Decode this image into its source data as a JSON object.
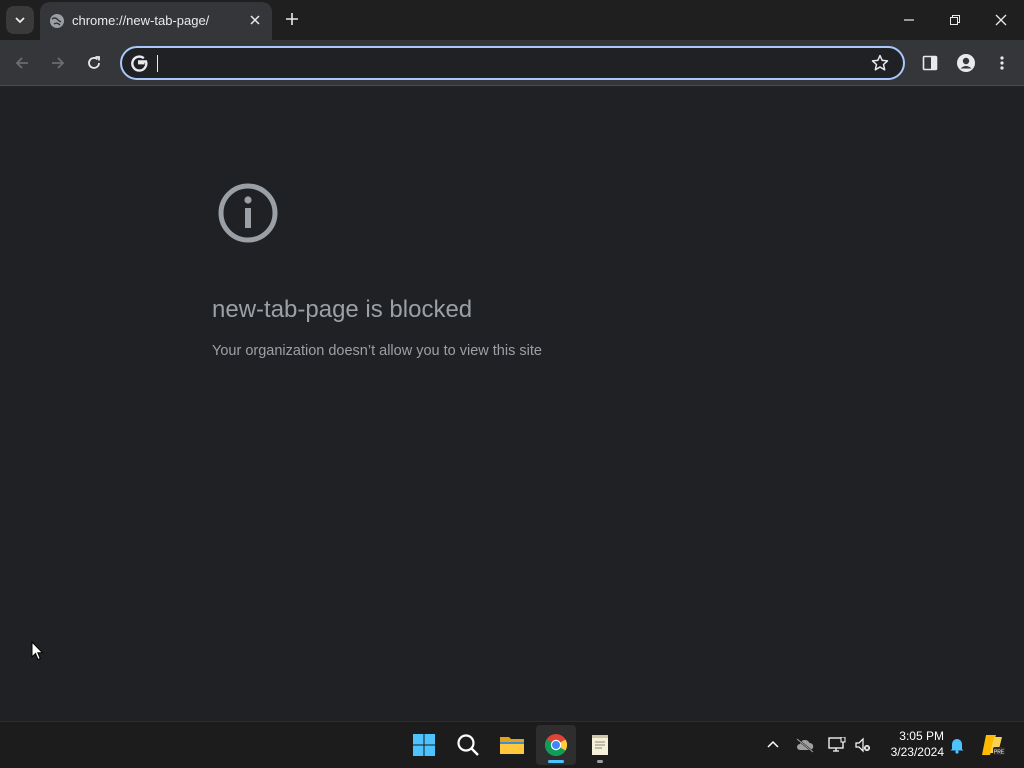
{
  "browser": {
    "tab": {
      "title": "chrome://new-tab-page/"
    },
    "omnibox": {
      "value": "",
      "placeholder": ""
    }
  },
  "page": {
    "headline": "new-tab-page is blocked",
    "message": "Your organization doesn’t allow you to view this site"
  },
  "taskbar": {
    "apps": [
      "start-icon",
      "search-icon",
      "file-explorer-icon",
      "chrome-icon",
      "notepad-icon"
    ],
    "clock": {
      "time": "3:05 PM",
      "date": "3/23/2024"
    }
  },
  "colors": {
    "accent": "#a8c7fa",
    "background": "#202124",
    "text_muted": "#9aa0a6"
  }
}
